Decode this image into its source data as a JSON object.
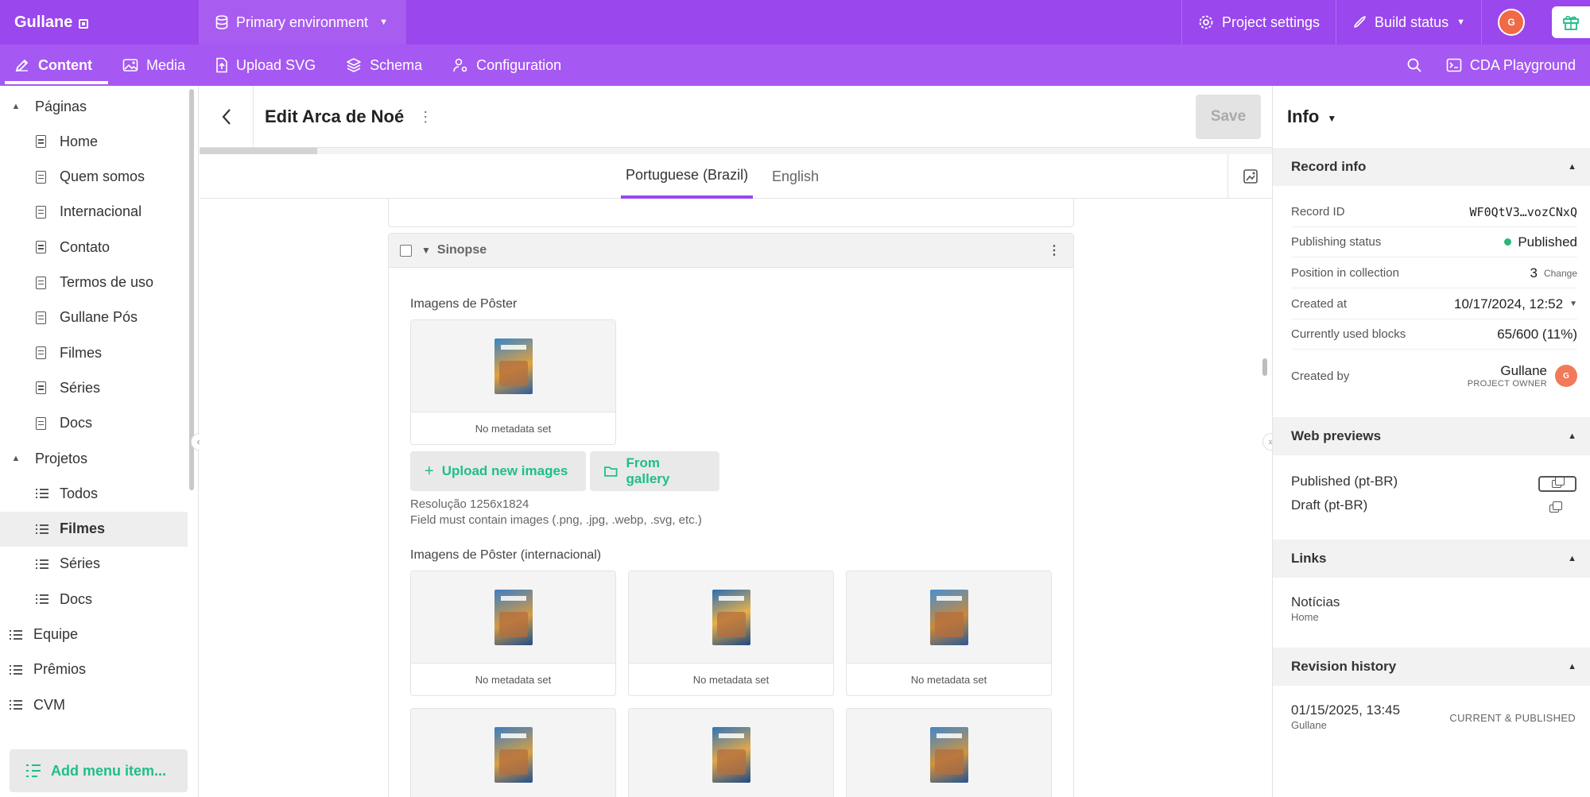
{
  "topbar": {
    "brand": "Gullane",
    "environment": "Primary environment",
    "project_settings": "Project settings",
    "build_status": "Build status",
    "avatar_initial": "G"
  },
  "navbar": {
    "tabs": [
      {
        "label": "Content",
        "icon": "pencil-icon",
        "active": true
      },
      {
        "label": "Media",
        "icon": "image-icon"
      },
      {
        "label": "Upload SVG",
        "icon": "upload-file-icon"
      },
      {
        "label": "Schema",
        "icon": "layers-icon"
      },
      {
        "label": "Configuration",
        "icon": "config-icon"
      }
    ],
    "cda_playground": "CDA Playground"
  },
  "sidebar": {
    "items": [
      {
        "label": "Páginas",
        "type": "group"
      },
      {
        "label": "Home",
        "type": "page"
      },
      {
        "label": "Quem somos",
        "type": "page"
      },
      {
        "label": "Internacional",
        "type": "page"
      },
      {
        "label": "Contato",
        "type": "page"
      },
      {
        "label": "Termos de uso",
        "type": "page"
      },
      {
        "label": "Gullane Pós",
        "type": "page"
      },
      {
        "label": "Filmes",
        "type": "page"
      },
      {
        "label": "Séries",
        "type": "page"
      },
      {
        "label": "Docs",
        "type": "page"
      },
      {
        "label": "Projetos",
        "type": "group"
      },
      {
        "label": "Todos",
        "type": "list"
      },
      {
        "label": "Filmes",
        "type": "list",
        "active": true
      },
      {
        "label": "Séries",
        "type": "list"
      },
      {
        "label": "Docs",
        "type": "list"
      },
      {
        "label": "Equipe",
        "type": "toplist"
      },
      {
        "label": "Prêmios",
        "type": "toplist"
      },
      {
        "label": "CVM",
        "type": "toplist"
      }
    ],
    "add_menu_item": "Add menu item..."
  },
  "editor": {
    "title": "Edit Arca de Noé",
    "save_label": "Save",
    "locales": [
      "Portuguese (Brazil)",
      "English"
    ],
    "block_title": "Sinopse",
    "poster_label": "Imagens de Pôster",
    "no_metadata": "No metadata set",
    "upload_new_images": "Upload new images",
    "from_gallery": "From gallery",
    "hint_resolution": "Resolução 1256x1824",
    "hint_formats": "Field must contain images (.png, .jpg, .webp, .svg, etc.)",
    "poster_intl_label": "Imagens de Pôster (internacional)"
  },
  "info_panel": {
    "title": "Info",
    "record_info": {
      "heading": "Record info",
      "record_id_label": "Record ID",
      "record_id": "WF0QtV3…vozCNxQ",
      "publishing_status_label": "Publishing status",
      "publishing_status": "Published",
      "position_label": "Position in collection",
      "position": "3",
      "change_link": "Change",
      "created_at_label": "Created at",
      "created_at": "10/17/2024, 12:52",
      "blocks_label": "Currently used blocks",
      "blocks": "65/600 (11%)",
      "created_by_label": "Created by",
      "created_by": "Gullane",
      "created_by_role": "PROJECT OWNER",
      "created_by_initial": "G"
    },
    "web_previews": {
      "heading": "Web previews",
      "published": "Published (pt-BR)",
      "draft": "Draft (pt-BR)"
    },
    "links": {
      "heading": "Links",
      "item_title": "Notícias",
      "item_sub": "Home"
    },
    "revision_history": {
      "heading": "Revision history",
      "date": "01/15/2025, 13:45",
      "author": "Gullane",
      "status": "CURRENT & PUBLISHED"
    }
  },
  "colors": {
    "brand_purple": "#9a47ed",
    "accent_green": "#1dbf87",
    "published_green": "#2bb673"
  }
}
